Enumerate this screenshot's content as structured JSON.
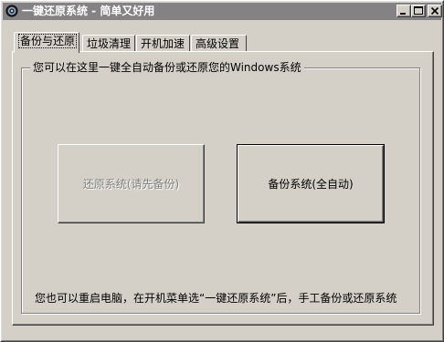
{
  "window": {
    "title": "一键还原系统 - 简单又好用"
  },
  "tabs": [
    {
      "label": "备份与还原",
      "active": true
    },
    {
      "label": "垃圾清理",
      "active": false
    },
    {
      "label": "开机加速",
      "active": false
    },
    {
      "label": "高级设置",
      "active": false
    }
  ],
  "panel": {
    "group_title": "您可以在这里一键全自动备份或还原您的Windows系统",
    "restore_button": "还原系统(请先备份)",
    "backup_button": "备份系统(全自动)",
    "note": "您也可以重启电脑，在开机菜单选“一键还原系统”后，手工备份或还原系统"
  },
  "colors": {
    "face": "#d4d0c8",
    "titlebar_inactive": "#848284",
    "disabled_text": "#808080"
  },
  "icons": {
    "app": "app-icon",
    "minimize": "minimize-icon",
    "maximize": "maximize-icon",
    "close": "close-icon"
  }
}
